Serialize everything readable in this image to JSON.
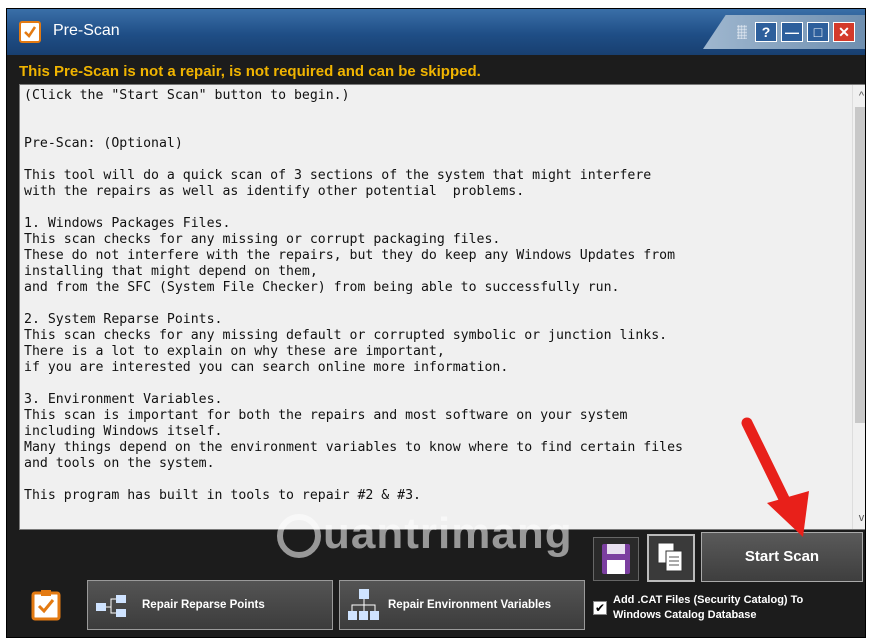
{
  "window": {
    "title": "Pre-Scan",
    "controls": {
      "help": "?",
      "minimize": "—",
      "maximize": "□",
      "close": "✕"
    }
  },
  "warning": "This Pre-Scan is not a repair, is not required and can be skipped.",
  "content": {
    "lines": [
      "(Click the \"Start Scan\" button to begin.)",
      "",
      "",
      "Pre-Scan: (Optional)",
      "",
      "This tool will do a quick scan of 3 sections of the system that might interfere",
      "with the repairs as well as identify other potential  problems.",
      "",
      "1. Windows Packages Files.",
      "This scan checks for any missing or corrupt packaging files.",
      "These do not interfere with the repairs, but they do keep any Windows Updates from",
      "installing that might depend on them,",
      "and from the SFC (System File Checker) from being able to successfully run.",
      "",
      "2. System Reparse Points.",
      "This scan checks for any missing default or corrupted symbolic or junction links.",
      "There is a lot to explain on why these are important,",
      "if you are interested you can search online more information.",
      "",
      "3. Environment Variables.",
      "This scan is important for both the repairs and most software on your system",
      "including Windows itself.",
      "Many things depend on the environment variables to know where to find certain files",
      "and tools on the system.",
      "",
      "This program has built in tools to repair #2 & #3."
    ]
  },
  "watermark": "uantrimang",
  "buttons": {
    "start_scan": "Start Scan",
    "repair_reparse": "Repair Reparse Points",
    "repair_env": "Repair Environment Variables"
  },
  "checkbox": {
    "checked": true,
    "label": "Add .CAT Files (Security Catalog) To Windows Catalog Database"
  },
  "colors": {
    "titlebar": "#2a5b94",
    "warning": "#f0b400",
    "close": "#d43a2a",
    "arrow": "#e8201a"
  }
}
